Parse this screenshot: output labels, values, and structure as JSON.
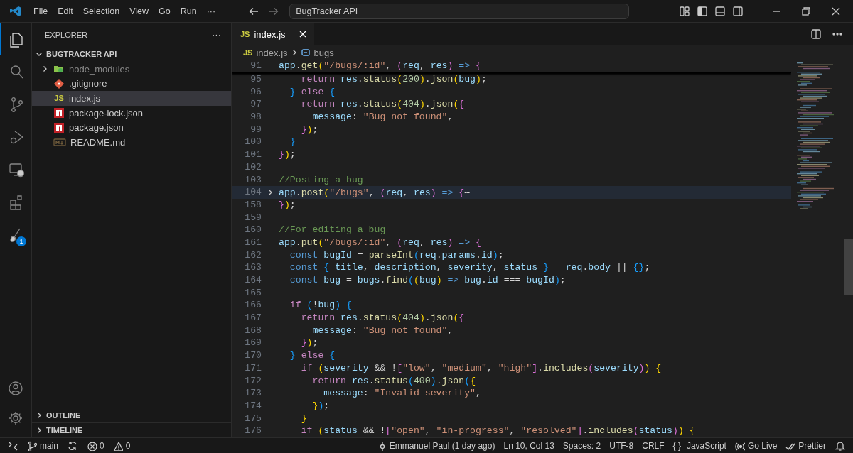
{
  "title_bar": {
    "menu": [
      "File",
      "Edit",
      "Selection",
      "View",
      "Go",
      "Run",
      "···"
    ],
    "command_center": "BugTracker API"
  },
  "activity_bar": {
    "items": [
      {
        "kind": "explorer",
        "selected": true
      },
      {
        "kind": "search",
        "selected": false
      },
      {
        "kind": "source-control",
        "selected": false
      },
      {
        "kind": "run-debug",
        "selected": false
      },
      {
        "kind": "remote",
        "selected": false
      },
      {
        "kind": "extensions",
        "selected": false
      },
      {
        "kind": "brush",
        "selected": false,
        "badge": "1"
      }
    ],
    "bottom": [
      {
        "kind": "account"
      },
      {
        "kind": "settings"
      }
    ]
  },
  "sidebar": {
    "title": "EXPLORER",
    "more": "···",
    "folder": {
      "name": "BUGTRACKER API",
      "expanded": true,
      "items": [
        {
          "name": "node_modules",
          "kind": "node-folder",
          "selected": false,
          "expanded": false
        },
        {
          "name": ".gitignore",
          "kind": "git",
          "selected": false
        },
        {
          "name": "index.js",
          "kind": "js",
          "icon_text": "JS",
          "selected": true
        },
        {
          "name": "package-lock.json",
          "kind": "npm",
          "selected": false
        },
        {
          "name": "package.json",
          "kind": "npm",
          "selected": false
        },
        {
          "name": "README.md",
          "kind": "markdown",
          "selected": false
        }
      ]
    },
    "sections": [
      {
        "name": "OUTLINE",
        "expanded": false
      },
      {
        "name": "TIMELINE",
        "expanded": false
      }
    ]
  },
  "editor": {
    "tabs": [
      {
        "label": "index.js",
        "icon_text": "JS",
        "selected": true
      }
    ],
    "breadcrumbs": [
      {
        "label": "index.js",
        "icon_text": "JS",
        "kind": "file"
      },
      {
        "label": "bugs",
        "kind": "symbol"
      }
    ],
    "sticky_line": {
      "number": "91",
      "tokens": [
        {
          "kind": "var",
          "t": "app"
        },
        {
          "kind": "punct",
          "t": "."
        },
        {
          "kind": "fn",
          "t": "get"
        },
        {
          "kind": "gold",
          "t": "("
        },
        {
          "kind": "str",
          "t": "\"/bugs/:id\""
        },
        {
          "kind": "punct",
          "t": ", "
        },
        {
          "kind": "pink",
          "t": "("
        },
        {
          "kind": "var",
          "t": "req"
        },
        {
          "kind": "punct",
          "t": ", "
        },
        {
          "kind": "var",
          "t": "res"
        },
        {
          "kind": "pink",
          "t": ")"
        },
        {
          "kind": "decl",
          "t": " => "
        },
        {
          "kind": "pink",
          "t": "{"
        }
      ]
    },
    "lines": [
      {
        "number": "95",
        "folded": false,
        "tokens": [
          {
            "kind": "kw",
            "t": "    return"
          },
          {
            "kind": "var",
            "t": " res"
          },
          {
            "kind": "punct",
            "t": "."
          },
          {
            "kind": "fn",
            "t": "status"
          },
          {
            "kind": "gold",
            "t": "("
          },
          {
            "kind": "num",
            "t": "200"
          },
          {
            "kind": "gold",
            "t": ")"
          },
          {
            "kind": "punct",
            "t": "."
          },
          {
            "kind": "fn",
            "t": "json"
          },
          {
            "kind": "gold",
            "t": "("
          },
          {
            "kind": "var",
            "t": "bug"
          },
          {
            "kind": "gold",
            "t": ")"
          },
          {
            "kind": "punct",
            "t": ";"
          }
        ]
      },
      {
        "number": "96",
        "folded": false,
        "tokens": [
          {
            "kind": "blue",
            "t": "  }"
          },
          {
            "kind": "kw",
            "t": " else "
          },
          {
            "kind": "blue",
            "t": "{"
          }
        ]
      },
      {
        "number": "97",
        "folded": false,
        "tokens": [
          {
            "kind": "kw",
            "t": "    return"
          },
          {
            "kind": "var",
            "t": " res"
          },
          {
            "kind": "punct",
            "t": "."
          },
          {
            "kind": "fn",
            "t": "status"
          },
          {
            "kind": "gold",
            "t": "("
          },
          {
            "kind": "num",
            "t": "404"
          },
          {
            "kind": "gold",
            "t": ")"
          },
          {
            "kind": "punct",
            "t": "."
          },
          {
            "kind": "fn",
            "t": "json"
          },
          {
            "kind": "gold",
            "t": "("
          },
          {
            "kind": "pink",
            "t": "{"
          }
        ]
      },
      {
        "number": "98",
        "folded": false,
        "tokens": [
          {
            "kind": "var",
            "t": "      message"
          },
          {
            "kind": "punct",
            "t": ": "
          },
          {
            "kind": "str",
            "t": "\"Bug not found\""
          },
          {
            "kind": "punct",
            "t": ","
          }
        ]
      },
      {
        "number": "99",
        "folded": false,
        "tokens": [
          {
            "kind": "pink",
            "t": "    }"
          },
          {
            "kind": "gold",
            "t": ")"
          },
          {
            "kind": "punct",
            "t": ";"
          }
        ]
      },
      {
        "number": "100",
        "folded": false,
        "tokens": [
          {
            "kind": "blue",
            "t": "  }"
          }
        ]
      },
      {
        "number": "101",
        "folded": false,
        "tokens": [
          {
            "kind": "pink",
            "t": "}"
          },
          {
            "kind": "gold",
            "t": ")"
          },
          {
            "kind": "punct",
            "t": ";"
          }
        ]
      },
      {
        "number": "102",
        "folded": false
      },
      {
        "number": "103",
        "folded": false,
        "tokens": [
          {
            "kind": "comment",
            "t": "//Posting a bug"
          }
        ]
      },
      {
        "number": "104",
        "folded": true,
        "tokens": [
          {
            "kind": "var",
            "t": "app"
          },
          {
            "kind": "punct",
            "t": "."
          },
          {
            "kind": "fn",
            "t": "post"
          },
          {
            "kind": "gold",
            "t": "("
          },
          {
            "kind": "str",
            "t": "\"/bugs\""
          },
          {
            "kind": "punct",
            "t": ", "
          },
          {
            "kind": "pink",
            "t": "("
          },
          {
            "kind": "var",
            "t": "req"
          },
          {
            "kind": "punct",
            "t": ", "
          },
          {
            "kind": "var",
            "t": "res"
          },
          {
            "kind": "pink",
            "t": ")"
          },
          {
            "kind": "decl",
            "t": " => "
          },
          {
            "kind": "pink",
            "t": "{"
          },
          {
            "kind": "punct",
            "t": "⋯"
          }
        ]
      },
      {
        "number": "158",
        "folded": false,
        "tokens": [
          {
            "kind": "pink",
            "t": "}"
          },
          {
            "kind": "gold",
            "t": ")"
          },
          {
            "kind": "punct",
            "t": ";"
          }
        ]
      },
      {
        "number": "159",
        "folded": false
      },
      {
        "number": "160",
        "folded": false,
        "tokens": [
          {
            "kind": "comment",
            "t": "//For editing a bug"
          }
        ]
      },
      {
        "number": "161",
        "folded": false,
        "tokens": [
          {
            "kind": "var",
            "t": "app"
          },
          {
            "kind": "punct",
            "t": "."
          },
          {
            "kind": "fn",
            "t": "put"
          },
          {
            "kind": "gold",
            "t": "("
          },
          {
            "kind": "str",
            "t": "\"/bugs/:id\""
          },
          {
            "kind": "punct",
            "t": ", "
          },
          {
            "kind": "pink",
            "t": "("
          },
          {
            "kind": "var",
            "t": "req"
          },
          {
            "kind": "punct",
            "t": ", "
          },
          {
            "kind": "var",
            "t": "res"
          },
          {
            "kind": "pink",
            "t": ")"
          },
          {
            "kind": "decl",
            "t": " => "
          },
          {
            "kind": "pink",
            "t": "{"
          }
        ]
      },
      {
        "number": "162",
        "folded": false,
        "tokens": [
          {
            "kind": "decl",
            "t": "  const"
          },
          {
            "kind": "var",
            "t": " bugId"
          },
          {
            "kind": "punct",
            "t": " = "
          },
          {
            "kind": "fn",
            "t": "parseInt"
          },
          {
            "kind": "blue",
            "t": "("
          },
          {
            "kind": "var",
            "t": "req"
          },
          {
            "kind": "punct",
            "t": "."
          },
          {
            "kind": "var",
            "t": "params"
          },
          {
            "kind": "punct",
            "t": "."
          },
          {
            "kind": "var",
            "t": "id"
          },
          {
            "kind": "blue",
            "t": ")"
          },
          {
            "kind": "punct",
            "t": ";"
          }
        ]
      },
      {
        "number": "163",
        "folded": false,
        "tokens": [
          {
            "kind": "decl",
            "t": "  const"
          },
          {
            "kind": "blue",
            "t": " {"
          },
          {
            "kind": "var",
            "t": " title"
          },
          {
            "kind": "punct",
            "t": ", "
          },
          {
            "kind": "var",
            "t": "description"
          },
          {
            "kind": "punct",
            "t": ", "
          },
          {
            "kind": "var",
            "t": "severity"
          },
          {
            "kind": "punct",
            "t": ", "
          },
          {
            "kind": "var",
            "t": "status"
          },
          {
            "kind": "blue",
            "t": " }"
          },
          {
            "kind": "punct",
            "t": " = "
          },
          {
            "kind": "var",
            "t": "req"
          },
          {
            "kind": "punct",
            "t": "."
          },
          {
            "kind": "var",
            "t": "body"
          },
          {
            "kind": "punct",
            "t": " || "
          },
          {
            "kind": "blue",
            "t": "{}"
          },
          {
            "kind": "punct",
            "t": ";"
          }
        ]
      },
      {
        "number": "164",
        "folded": false,
        "tokens": [
          {
            "kind": "decl",
            "t": "  const"
          },
          {
            "kind": "var",
            "t": " bug"
          },
          {
            "kind": "punct",
            "t": " = "
          },
          {
            "kind": "var",
            "t": "bugs"
          },
          {
            "kind": "punct",
            "t": "."
          },
          {
            "kind": "fn",
            "t": "find"
          },
          {
            "kind": "blue",
            "t": "("
          },
          {
            "kind": "gold",
            "t": "("
          },
          {
            "kind": "var",
            "t": "bug"
          },
          {
            "kind": "gold",
            "t": ")"
          },
          {
            "kind": "decl",
            "t": " => "
          },
          {
            "kind": "var",
            "t": "bug"
          },
          {
            "kind": "punct",
            "t": "."
          },
          {
            "kind": "var",
            "t": "id"
          },
          {
            "kind": "punct",
            "t": " === "
          },
          {
            "kind": "var",
            "t": "bugId"
          },
          {
            "kind": "blue",
            "t": ")"
          },
          {
            "kind": "punct",
            "t": ";"
          }
        ]
      },
      {
        "number": "165",
        "folded": false
      },
      {
        "number": "166",
        "folded": false,
        "tokens": [
          {
            "kind": "kw",
            "t": "  if"
          },
          {
            "kind": "blue",
            "t": " ("
          },
          {
            "kind": "punct",
            "t": "!"
          },
          {
            "kind": "var",
            "t": "bug"
          },
          {
            "kind": "blue",
            "t": ")"
          },
          {
            "kind": "blue",
            "t": " {"
          }
        ]
      },
      {
        "number": "167",
        "folded": false,
        "tokens": [
          {
            "kind": "kw",
            "t": "    return"
          },
          {
            "kind": "var",
            "t": " res"
          },
          {
            "kind": "punct",
            "t": "."
          },
          {
            "kind": "fn",
            "t": "status"
          },
          {
            "kind": "gold",
            "t": "("
          },
          {
            "kind": "num",
            "t": "404"
          },
          {
            "kind": "gold",
            "t": ")"
          },
          {
            "kind": "punct",
            "t": "."
          },
          {
            "kind": "fn",
            "t": "json"
          },
          {
            "kind": "gold",
            "t": "("
          },
          {
            "kind": "pink",
            "t": "{"
          }
        ]
      },
      {
        "number": "168",
        "folded": false,
        "tokens": [
          {
            "kind": "var",
            "t": "      message"
          },
          {
            "kind": "punct",
            "t": ": "
          },
          {
            "kind": "str",
            "t": "\"Bug not found\""
          },
          {
            "kind": "punct",
            "t": ","
          }
        ]
      },
      {
        "number": "169",
        "folded": false,
        "tokens": [
          {
            "kind": "pink",
            "t": "    }"
          },
          {
            "kind": "gold",
            "t": ")"
          },
          {
            "kind": "punct",
            "t": ";"
          }
        ]
      },
      {
        "number": "170",
        "folded": false,
        "tokens": [
          {
            "kind": "blue",
            "t": "  }"
          },
          {
            "kind": "kw",
            "t": " else "
          },
          {
            "kind": "blue",
            "t": "{"
          }
        ]
      },
      {
        "number": "171",
        "folded": false,
        "tokens": [
          {
            "kind": "kw",
            "t": "    if"
          },
          {
            "kind": "gold",
            "t": " ("
          },
          {
            "kind": "var",
            "t": "severity"
          },
          {
            "kind": "punct",
            "t": " && !"
          },
          {
            "kind": "pink",
            "t": "["
          },
          {
            "kind": "str",
            "t": "\"low\""
          },
          {
            "kind": "punct",
            "t": ", "
          },
          {
            "kind": "str",
            "t": "\"medium\""
          },
          {
            "kind": "punct",
            "t": ", "
          },
          {
            "kind": "str",
            "t": "\"high\""
          },
          {
            "kind": "pink",
            "t": "]"
          },
          {
            "kind": "punct",
            "t": "."
          },
          {
            "kind": "fn",
            "t": "includes"
          },
          {
            "kind": "pink",
            "t": "("
          },
          {
            "kind": "var",
            "t": "severity"
          },
          {
            "kind": "pink",
            "t": ")"
          },
          {
            "kind": "gold",
            "t": ")"
          },
          {
            "kind": "gold",
            "t": " {"
          }
        ]
      },
      {
        "number": "172",
        "folded": false,
        "tokens": [
          {
            "kind": "kw",
            "t": "      return"
          },
          {
            "kind": "var",
            "t": " res"
          },
          {
            "kind": "punct",
            "t": "."
          },
          {
            "kind": "fn",
            "t": "status"
          },
          {
            "kind": "blue",
            "t": "("
          },
          {
            "kind": "num",
            "t": "400"
          },
          {
            "kind": "blue",
            "t": ")"
          },
          {
            "kind": "punct",
            "t": "."
          },
          {
            "kind": "fn",
            "t": "json"
          },
          {
            "kind": "blue",
            "t": "("
          },
          {
            "kind": "gold",
            "t": "{"
          }
        ]
      },
      {
        "number": "173",
        "folded": false,
        "tokens": [
          {
            "kind": "var",
            "t": "        message"
          },
          {
            "kind": "punct",
            "t": ": "
          },
          {
            "kind": "str",
            "t": "\"Invalid severity\""
          },
          {
            "kind": "punct",
            "t": ","
          }
        ]
      },
      {
        "number": "174",
        "folded": false,
        "tokens": [
          {
            "kind": "gold",
            "t": "      }"
          },
          {
            "kind": "blue",
            "t": ")"
          },
          {
            "kind": "punct",
            "t": ";"
          }
        ]
      },
      {
        "number": "175",
        "folded": false,
        "tokens": [
          {
            "kind": "gold",
            "t": "    }"
          }
        ]
      },
      {
        "number": "176",
        "folded": false,
        "tokens": [
          {
            "kind": "kw",
            "t": "    if"
          },
          {
            "kind": "gold",
            "t": " ("
          },
          {
            "kind": "var",
            "t": "status"
          },
          {
            "kind": "punct",
            "t": " && !"
          },
          {
            "kind": "pink",
            "t": "["
          },
          {
            "kind": "str",
            "t": "\"open\""
          },
          {
            "kind": "punct",
            "t": ", "
          },
          {
            "kind": "str",
            "t": "\"in-progress\""
          },
          {
            "kind": "punct",
            "t": ", "
          },
          {
            "kind": "str",
            "t": "\"resolved\""
          },
          {
            "kind": "pink",
            "t": "]"
          },
          {
            "kind": "punct",
            "t": "."
          },
          {
            "kind": "fn",
            "t": "includes"
          },
          {
            "kind": "pink",
            "t": "("
          },
          {
            "kind": "var",
            "t": "status"
          },
          {
            "kind": "pink",
            "t": ")"
          },
          {
            "kind": "gold",
            "t": ")"
          },
          {
            "kind": "gold",
            "t": " {"
          }
        ]
      }
    ]
  },
  "status_bar": {
    "left": [
      {
        "kind": "remote"
      },
      {
        "kind": "branch",
        "text": "main"
      },
      {
        "kind": "sync"
      },
      {
        "kind": "errors",
        "text": "0"
      },
      {
        "kind": "warnings",
        "text": "0"
      }
    ],
    "right": [
      {
        "kind": "blame",
        "text": "Emmanuel Paul (1 day ago)"
      },
      {
        "kind": "text",
        "text": "Ln 10, Col 13"
      },
      {
        "kind": "text",
        "text": "Spaces: 2"
      },
      {
        "kind": "text",
        "text": "UTF-8"
      },
      {
        "kind": "text",
        "text": "CRLF"
      },
      {
        "kind": "language",
        "prefix": "{ }",
        "text": "JavaScript"
      },
      {
        "kind": "live",
        "text": "Go Live"
      },
      {
        "kind": "prettier",
        "text": "Prettier"
      },
      {
        "kind": "bell"
      }
    ]
  }
}
